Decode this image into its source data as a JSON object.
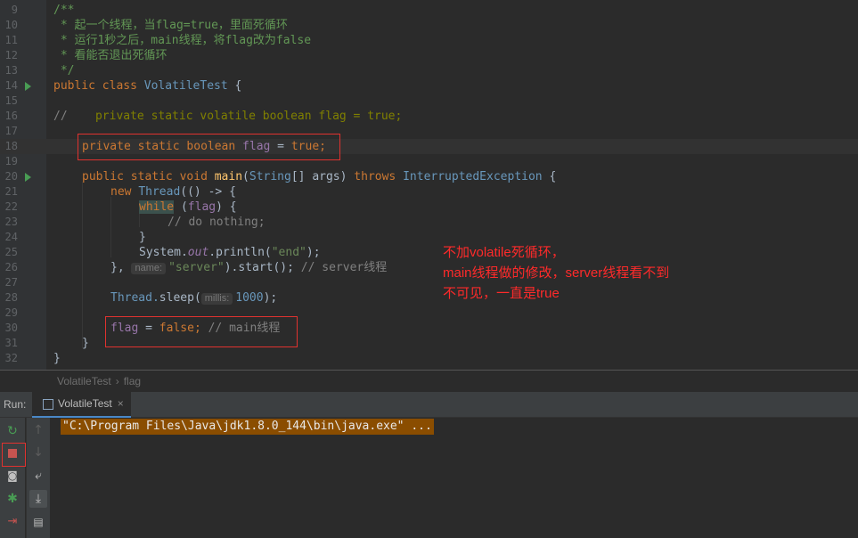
{
  "editor": {
    "lines": [
      {
        "n": "9",
        "t": "/**"
      },
      {
        "n": "10",
        "t": " * 起一个线程，当flag=true，里面死循环"
      },
      {
        "n": "11",
        "t": " * 运行1秒之后，main线程，将flag改为false"
      },
      {
        "n": "12",
        "t": " * 看能否退出死循环"
      },
      {
        "n": "13",
        "t": " */"
      },
      {
        "n": "14"
      },
      {
        "n": "15"
      },
      {
        "n": "16"
      },
      {
        "n": "17"
      },
      {
        "n": "18"
      },
      {
        "n": "19"
      },
      {
        "n": "20"
      },
      {
        "n": "21"
      },
      {
        "n": "22"
      },
      {
        "n": "23"
      },
      {
        "n": "24"
      },
      {
        "n": "25"
      },
      {
        "n": "26"
      },
      {
        "n": "27"
      },
      {
        "n": "28"
      },
      {
        "n": "29"
      },
      {
        "n": "30"
      },
      {
        "n": "31"
      },
      {
        "n": "32"
      }
    ],
    "tokens": {
      "public": "public",
      "class": "class",
      "class_name": "VolatileTest",
      "brace_open": " {",
      "comment16_prefix": "//",
      "comment16_body": "    private static volatile boolean flag = true;",
      "private": "private",
      "static": "static",
      "boolean": "boolean",
      "flag": "flag",
      "assign": " = ",
      "true": "true",
      "semi": ";",
      "void": "void",
      "main": "main",
      "string_type": "String",
      "args_part": "[] args) ",
      "throws": "throws",
      "exception": "InterruptedException",
      "new": "new",
      "thread": "Thread",
      "lambda": "(() -> {",
      "while": "while",
      "while_cond_open": " (",
      "while_cond_close": ") {",
      "do_nothing": "// do nothing;",
      "close_brace": "}",
      "system": "System.",
      "out": "out",
      "println": ".println(",
      "end_str": "\"end\"",
      "close_call": ");",
      "line26_start": "}, ",
      "hint_name": "name:",
      "server_str": "\"server\"",
      "start_call": ").start(); ",
      "comment_server": "// server线程",
      "thread_sleep": "Thread.",
      "sleep": "sleep",
      "paren_open": "(",
      "hint_millis": "millis:",
      "num_1000": "1000",
      "false": "false",
      "comment_main": "// main线程",
      "paren_main_open": "("
    }
  },
  "annotation": {
    "line1": "不加volatile死循环，",
    "line2": "main线程做的修改，server线程看不到",
    "line3": "不可见，一直是true"
  },
  "breadcrumb": {
    "class": "VolatileTest",
    "separator": "›",
    "member": "flag"
  },
  "run_panel": {
    "label": "Run:",
    "tab_title": "VolatileTest",
    "tab_close": "×",
    "console_line": "\"C:\\Program Files\\Java\\jdk1.8.0_144\\bin\\java.exe\" ..."
  },
  "icons": {
    "rerun": "rerun-icon",
    "stop": "stop-icon",
    "up": "arrow-up-icon",
    "down": "arrow-down-icon",
    "snapshot": "camera-icon",
    "wrap": "soft-wrap-icon",
    "debug": "bug-icon",
    "scroll": "scroll-to-end-icon",
    "exit": "exit-icon",
    "print": "print-icon"
  },
  "colors": {
    "stop_red": "#c75450",
    "rerun_green": "#499c54",
    "annotation_red": "#ff2a2a",
    "box_red": "#e0322f"
  }
}
